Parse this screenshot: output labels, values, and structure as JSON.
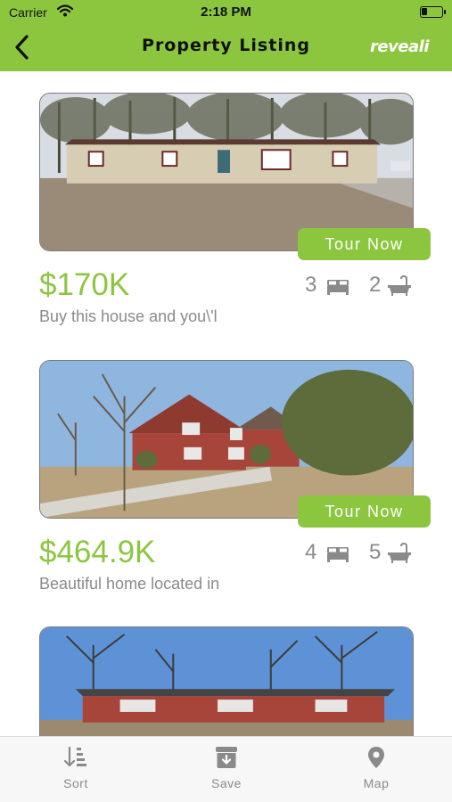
{
  "status_bar": {
    "carrier": "Carrier",
    "time": "2:18 PM"
  },
  "nav": {
    "title": "Property Listing",
    "brand": "reveali"
  },
  "listings": [
    {
      "price": "$170K",
      "description": "Buy this house and you\\'l",
      "beds": "3",
      "baths": "2",
      "tour_label": "Tour Now"
    },
    {
      "price": "$464.9K",
      "description": "Beautiful home located in",
      "beds": "4",
      "baths": "5",
      "tour_label": "Tour Now"
    },
    {
      "price": "",
      "description": "",
      "beds": "",
      "baths": "",
      "tour_label": ""
    }
  ],
  "tabs": [
    {
      "label": "Sort",
      "icon": "sort-icon"
    },
    {
      "label": "Save",
      "icon": "save-icon"
    },
    {
      "label": "Map",
      "icon": "map-pin-icon"
    }
  ],
  "colors": {
    "accent": "#8cc63f",
    "text_muted": "#8a8a8a",
    "tab_bar": "#f7f7f7"
  }
}
